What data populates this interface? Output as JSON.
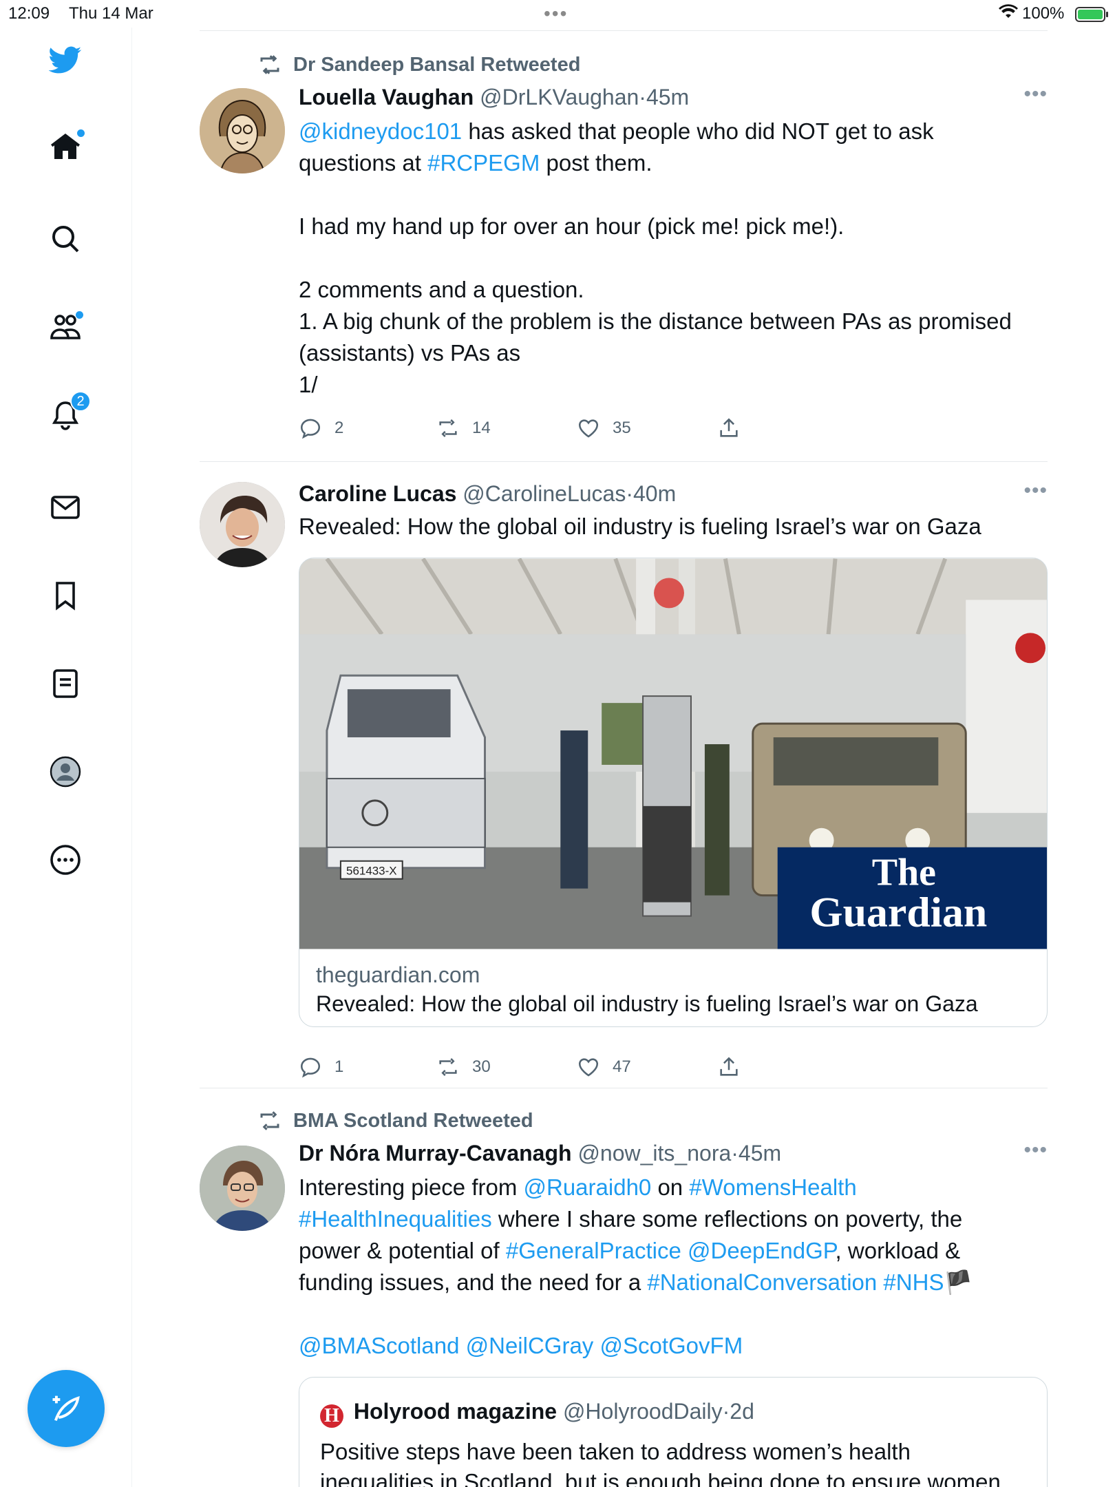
{
  "status_bar": {
    "time": "12:09",
    "date": "Thu 14 Mar",
    "battery": "100%"
  },
  "sidebar": {
    "notifications_badge": "2"
  },
  "tweets": [
    {
      "retweeted_by": "Dr Sandeep Bansal Retweeted",
      "name": "Louella Vaughan",
      "handle": "@DrLKVaughan",
      "time": "45m",
      "lines": [
        [
          {
            "t": "@kidneydoc101",
            "link": true
          },
          {
            "t": " has asked that people who did NOT get to ask"
          }
        ],
        [
          {
            "t": "questions at "
          },
          {
            "t": "#RCPEGM",
            "link": true
          },
          {
            "t": " post them."
          }
        ],
        [],
        [
          {
            "t": "I had my hand up for over an hour (pick me! pick me!)."
          }
        ],
        [],
        [
          {
            "t": "2 comments and a question."
          }
        ],
        [
          {
            "t": "1. A big chunk of the problem is the distance between PAs as promised"
          }
        ],
        [
          {
            "t": "(assistants) vs PAs as"
          }
        ],
        [
          {
            "t": "1/"
          }
        ]
      ],
      "replies": "2",
      "retweets": "14",
      "likes": "35"
    },
    {
      "name": "Caroline Lucas",
      "handle": "@CarolineLucas",
      "time": "40m",
      "lines": [
        [
          {
            "t": "Revealed: How the global oil industry is fueling Israel’s war on Gaza"
          }
        ]
      ],
      "card": {
        "domain": "theguardian.com",
        "title": "Revealed: How the global oil industry is fueling Israel’s war on Gaza",
        "brand_line1": "The",
        "brand_line2": "Guardian",
        "plate": "561433-X"
      },
      "replies": "1",
      "retweets": "30",
      "likes": "47"
    },
    {
      "retweeted_by": "BMA Scotland Retweeted",
      "name": "Dr Nóra Murray-Cavanagh",
      "handle": "@now_its_nora",
      "time": "45m",
      "lines": [
        [
          {
            "t": "Interesting piece from "
          },
          {
            "t": "@Ruaraidh0",
            "link": true
          },
          {
            "t": " on "
          },
          {
            "t": "#WomensHealth",
            "link": true
          }
        ],
        [
          {
            "t": "#HealthInequalities",
            "link": true
          },
          {
            "t": " where I share some reflections on poverty, the"
          }
        ],
        [
          {
            "t": "power & potential of "
          },
          {
            "t": "#GeneralPractice",
            "link": true
          },
          {
            "t": " "
          },
          {
            "t": "@DeepEndGP",
            "link": true
          },
          {
            "t": ", workload &"
          }
        ],
        [
          {
            "t": "funding issues, and the need for a "
          },
          {
            "t": "#NationalConversation",
            "link": true
          },
          {
            "t": " "
          },
          {
            "t": "#NHS",
            "link": true
          },
          {
            "t": "🏴"
          }
        ],
        [],
        [
          {
            "t": " "
          },
          {
            "t": "@BMAScotland",
            "link": true
          },
          {
            "t": " "
          },
          {
            "t": "@NeilCGray",
            "link": true
          },
          {
            "t": " "
          },
          {
            "t": "@ScotGovFM",
            "link": true
          }
        ]
      ],
      "quote": {
        "logo_letter": "H",
        "name": "Holyrood magazine",
        "handle": "@HolyroodDaily",
        "time": "2d",
        "line1": "Positive steps have been taken to address women’s health",
        "line2": "inequalities in Scotland, but is enough being done to ensure women"
      }
    }
  ]
}
